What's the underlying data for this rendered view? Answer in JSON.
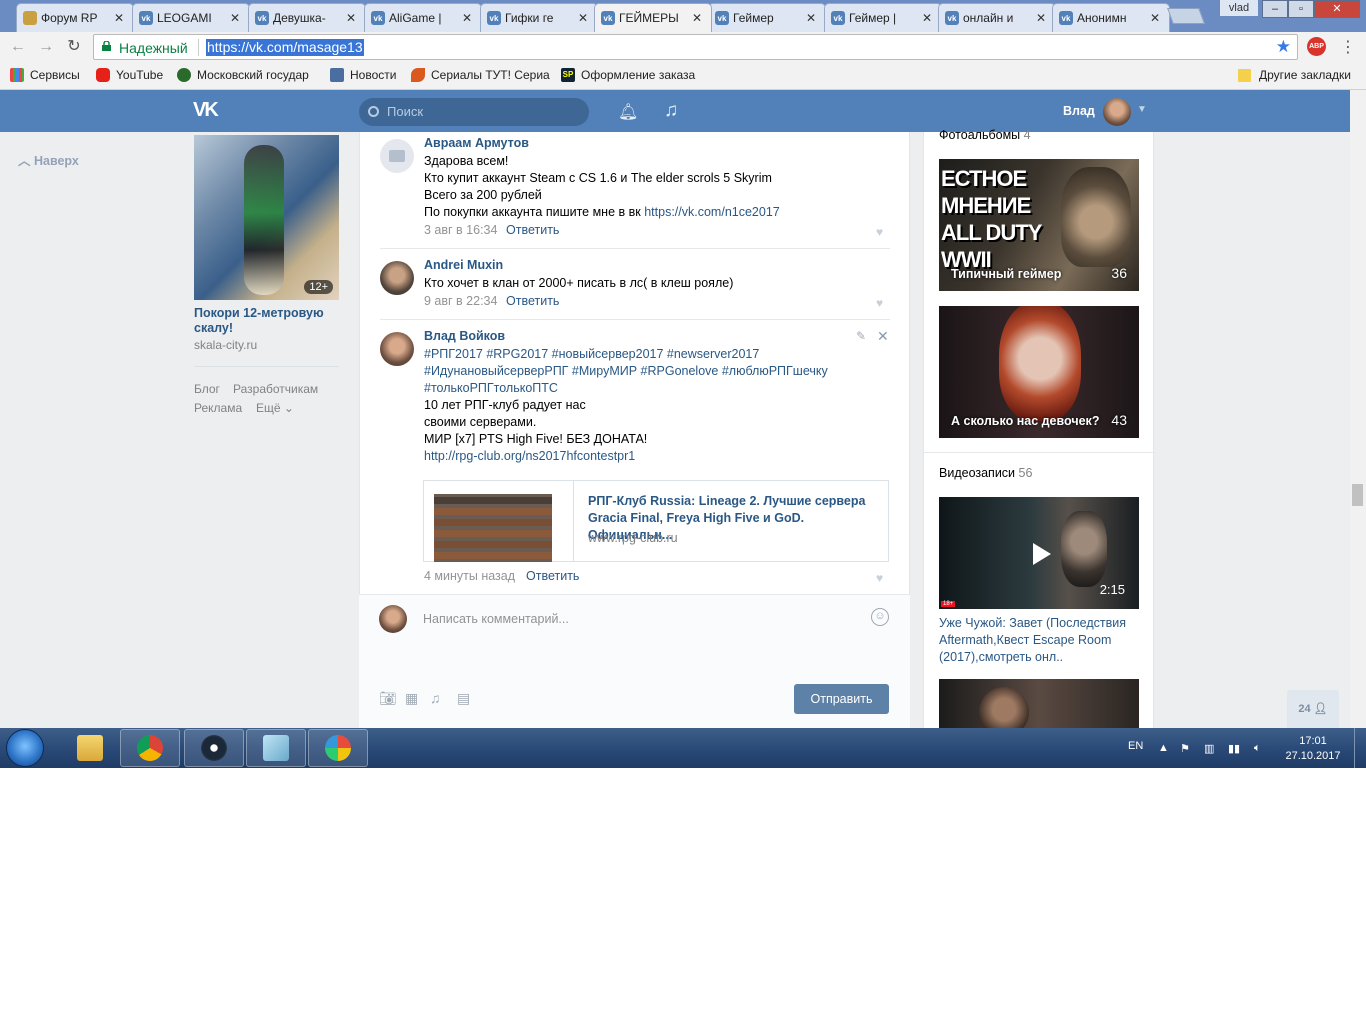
{
  "browser": {
    "tabs": [
      {
        "title": "Форум RP",
        "active": false
      },
      {
        "title": "LEOGAMI",
        "active": false
      },
      {
        "title": "Девушка-",
        "active": false
      },
      {
        "title": "AliGame |",
        "active": false
      },
      {
        "title": "Гифки ге",
        "active": false
      },
      {
        "title": "ГЕЙМЕРЫ",
        "active": true
      },
      {
        "title": "Геймер",
        "active": false
      },
      {
        "title": "Геймер |",
        "active": false
      },
      {
        "title": "онлайн и",
        "active": false
      },
      {
        "title": "Анонимн",
        "active": false
      }
    ],
    "tab_close": "✕",
    "window_user": "vlad",
    "security_label": "Надежный",
    "url": "https://vk.com/masage13",
    "abp_label": "ABP",
    "bookmarks": [
      "Сервисы",
      "YouTube",
      "Московский государ",
      "Новости",
      "Сериалы ТУТ! Сериа",
      "Оформление заказа"
    ],
    "other_bookmarks": "Другие закладки"
  },
  "vk": {
    "search_placeholder": "Поиск",
    "user_name": "Влад",
    "back_to_top": "Наверх",
    "ad": {
      "age": "12+",
      "title": "Покори 12-метровую скалу!",
      "domain": "skala-city.ru"
    },
    "footer_links": [
      "Блог",
      "Разработчикам",
      "Реклама",
      "Ещё"
    ],
    "posts": [
      {
        "author": "Авраам Армутов",
        "lines": [
          "Здарова всем!",
          "Кто купит аккаунт Steam с CS 1.6 и The elder scrols 5 Skyrim",
          "Всего за 200 рублей",
          "По покупки аккаунта пишите мне в вк"
        ],
        "link": "https://vk.com/n1ce2017",
        "date": "3 авг в 16:34",
        "reply": "Ответить"
      },
      {
        "author": "Andrei Muxin",
        "lines": [
          "Кто хочет в клан от 2000+ писать в лс( в клеш рояле)"
        ],
        "date": "9 авг в 22:34",
        "reply": "Ответить"
      },
      {
        "author": "Влад Войков",
        "lines": [
          "#РПГ2017 #RPG2017 #новыйсервер2017 #newserver2017",
          "#ИдунановыйсерверРПГ #МируМИР #RPGonelove #люблюРПГшечку",
          "#толькоРПГтолькоПТС",
          "10 лет РПГ-клуб радует нас",
          "своими серверами.",
          "МИР [x7] PTS High Five! БЕЗ ДОНАТА!"
        ],
        "link": "http://rpg-club.org/ns2017hfcontestpr1",
        "card": {
          "title": "РПГ-Клуб Russia: Lineage 2. Лучшие сервера Gracia Final, Freya High Five и GoD. Официальн...",
          "domain": "www.rpg-club.ru"
        },
        "date": "4 минуты назад",
        "reply": "Ответить"
      }
    ],
    "comment_placeholder": "Написать комментарий...",
    "send_label": "Отправить",
    "albums_header": "Фотоальбомы",
    "albums_count": "4",
    "albums": [
      {
        "caption": "Типичный геймер",
        "count": "36",
        "overlay": "ЕСТНОЕ МНЕНИЕ ALL DUTY WWII"
      },
      {
        "caption": "А сколько нас девочек?",
        "count": "43"
      }
    ],
    "videos_header": "Видеозаписи",
    "videos_count": "56",
    "video": {
      "duration": "2:15",
      "badge": "18+",
      "title": "Уже Чужой: Завет (Последствия Aftermath,Квест Escape Room (2017),смотреть онл.."
    },
    "online_count": "24"
  },
  "taskbar": {
    "lang": "EN",
    "time": "17:01",
    "date": "27.10.2017"
  },
  "colors": {
    "vk_blue": "#5181b8",
    "link": "#2a5885",
    "send_button": "#5e81a8"
  }
}
